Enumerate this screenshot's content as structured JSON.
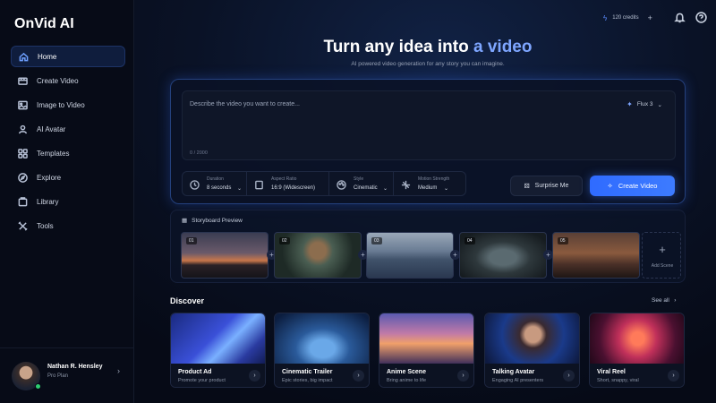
{
  "app": {
    "name": "OnVid AI"
  },
  "nav": [
    {
      "label": "Home",
      "icon": "home-icon",
      "active": true
    },
    {
      "label": "Create Video",
      "icon": "video-icon"
    },
    {
      "label": "Image to Video",
      "icon": "image-icon"
    },
    {
      "label": "AI Avatar",
      "icon": "user-icon"
    },
    {
      "label": "Templates",
      "icon": "grid-icon"
    },
    {
      "label": "Explore",
      "icon": "compass-icon"
    },
    {
      "label": "Library",
      "icon": "library-icon"
    },
    {
      "label": "Tools",
      "icon": "tools-icon"
    }
  ],
  "user": {
    "name": "Nathan R. Hensley",
    "plan": "Pro Plan",
    "status": "online"
  },
  "topbar": {
    "credits": "120 credits",
    "plus": "+"
  },
  "hero": {
    "title_main": "Turn any idea into",
    "title_accent": "a video",
    "subtitle": "AI powered video generation for any story you can imagine."
  },
  "composer": {
    "placeholder": "Describe the video you want to create...",
    "counter": "0 / 2000",
    "model": "Flux 3",
    "settings": [
      {
        "label": "Duration",
        "value": "8 seconds",
        "icon": "clock-icon"
      },
      {
        "label": "Aspect Ratio",
        "value": "16:9 (Widescreen)",
        "icon": "aspect-ratio-icon"
      },
      {
        "label": "Style",
        "value": "Cinematic",
        "icon": "palette-icon"
      },
      {
        "label": "Motion Strength",
        "value": "Medium",
        "icon": "motion-icon"
      }
    ],
    "surprise_label": "Surprise Me",
    "create_label": "Create Video"
  },
  "storyboard": {
    "title": "Storyboard Preview",
    "frames": [
      "01",
      "02",
      "03",
      "04",
      "05"
    ],
    "add_label": "Add Scene"
  },
  "discover": {
    "title": "Discover",
    "see_all": "See all",
    "cards": [
      {
        "title": "Product Ad",
        "desc": "Promote your product"
      },
      {
        "title": "Cinematic Trailer",
        "desc": "Epic stories, big impact"
      },
      {
        "title": "Anime Scene",
        "desc": "Bring anime to life"
      },
      {
        "title": "Talking Avatar",
        "desc": "Engaging AI presenters"
      },
      {
        "title": "Viral Reel",
        "desc": "Short, snappy, viral"
      }
    ]
  },
  "colors": {
    "accent": "#3d7bff",
    "accent_text": "#7ea6ff",
    "background": "#060a16"
  }
}
